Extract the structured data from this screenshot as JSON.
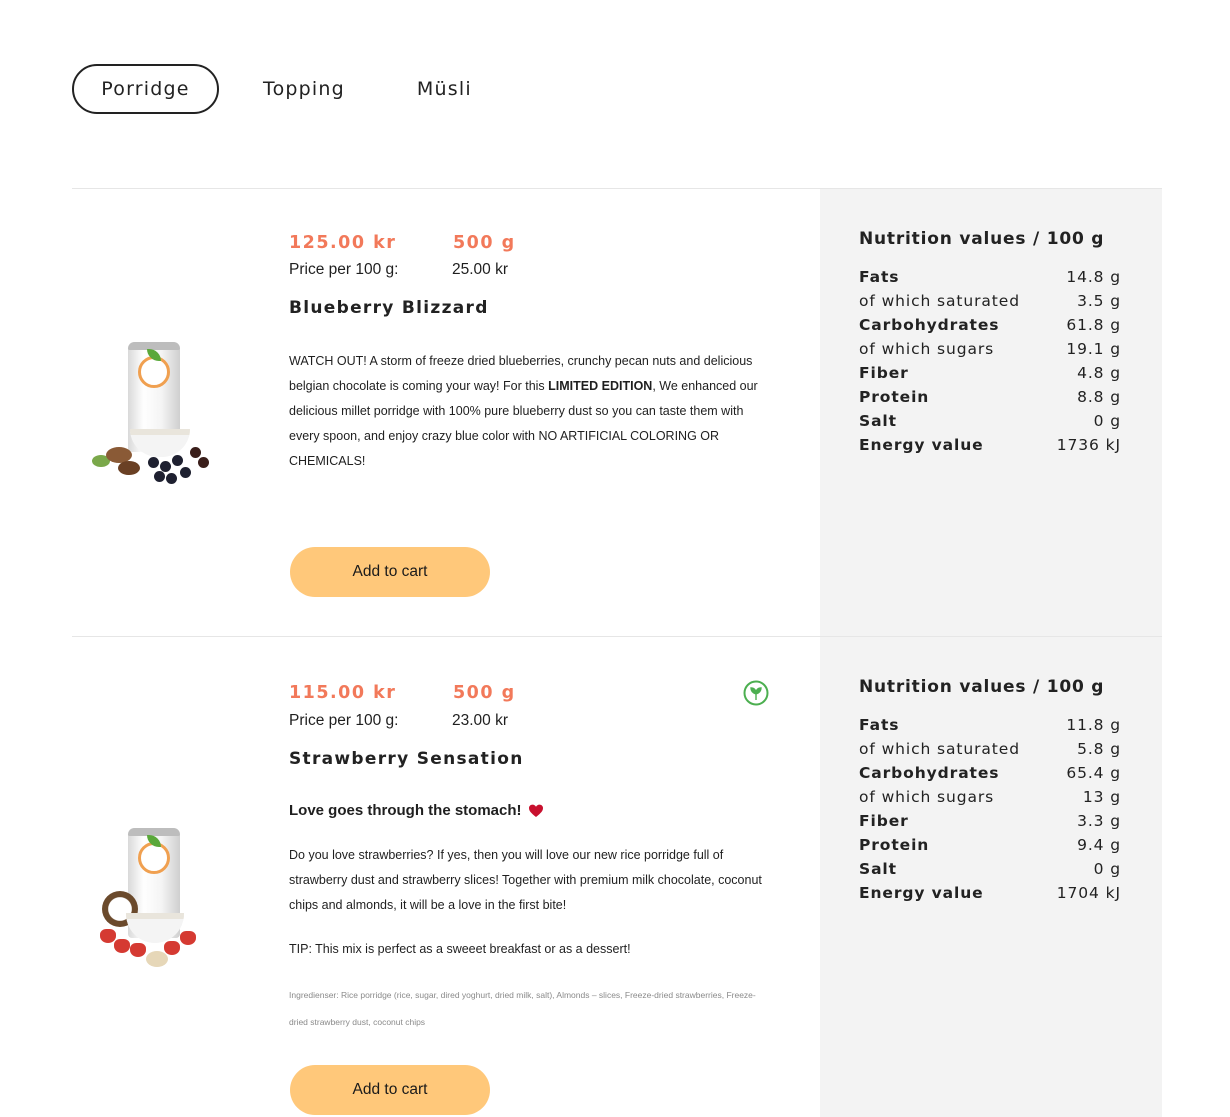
{
  "tabs": [
    {
      "label": "Porridge",
      "active": true
    },
    {
      "label": "Topping",
      "active": false
    },
    {
      "label": "Müsli",
      "active": false
    }
  ],
  "products": [
    {
      "price": "125.00 kr",
      "weight": "500 g",
      "price_per_label": "Price per 100 g:",
      "price_per_value": "25.00 kr",
      "name": "Blueberry Blizzard",
      "description": {
        "part1": "WATCH OUT! A storm of freeze dried blueberries, crunchy pecan nuts and delicious belgian chocolate is coming your way! For this ",
        "bold": "LIMITED EDITION",
        "part2": ", We enhanced our delicious millet porridge with 100% pure blueberry dust so you can taste them with every spoon, and enjoy crazy blue color with NO ARTIFICIAL COLORING OR CHEMICALS!"
      },
      "add_to_cart": "Add to cart",
      "nutrition": {
        "title": "Nutrition values / 100 g",
        "rows": [
          {
            "label": "Fats",
            "value": "14.8 g"
          },
          {
            "label": "of which saturated",
            "value": "3.5 g"
          },
          {
            "label": "Carbohydrates",
            "value": "61.8 g"
          },
          {
            "label": "of which sugars",
            "value": "19.1 g"
          },
          {
            "label": "Fiber",
            "value": "4.8 g"
          },
          {
            "label": "Protein",
            "value": "8.8 g"
          },
          {
            "label": "Salt",
            "value": "0 g"
          },
          {
            "label": "Energy value",
            "value": "1736 kJ"
          }
        ]
      }
    },
    {
      "price": "115.00 kr",
      "weight": "500 g",
      "price_per_label": "Price per 100 g:",
      "price_per_value": "23.00 kr",
      "name": "Strawberry Sensation",
      "tagline": "Love goes through the stomach!",
      "description": "Do you love strawberries? If yes, then you will love our new rice porridge full of strawberry dust and strawberry slices! Together with premium milk chocolate, coconut chips and almonds, it will be a love in the first bite!",
      "tip": "TIP: This mix is perfect as a sweeet breakfast or as a dessert!",
      "ingredients": "Ingredienser: Rice porridge (rice, sugar, dired yoghurt, dried milk, salt), Almonds – slices, Freeze-dried strawberries, Freeze-dried strawberry dust, coconut chips",
      "add_to_cart": "Add to cart",
      "nutrition": {
        "title": "Nutrition values / 100 g",
        "rows": [
          {
            "label": "Fats",
            "value": "11.8 g"
          },
          {
            "label": "of which saturated",
            "value": "5.8 g"
          },
          {
            "label": "Carbohydrates",
            "value": "65.4 g"
          },
          {
            "label": "of which sugars",
            "value": "13 g"
          },
          {
            "label": "Fiber",
            "value": "3.3 g"
          },
          {
            "label": "Protein",
            "value": "9.4 g"
          },
          {
            "label": "Salt",
            "value": "0 g"
          },
          {
            "label": "Energy value",
            "value": "1704 kJ"
          }
        ]
      }
    }
  ],
  "colors": {
    "price": "#f2795a",
    "button": "#ffc87a",
    "panel": "#f3f3f3",
    "vegan": "#4caf50",
    "heart": "#c8102e"
  },
  "icons": [
    "vegan-icon",
    "heart-icon"
  ]
}
